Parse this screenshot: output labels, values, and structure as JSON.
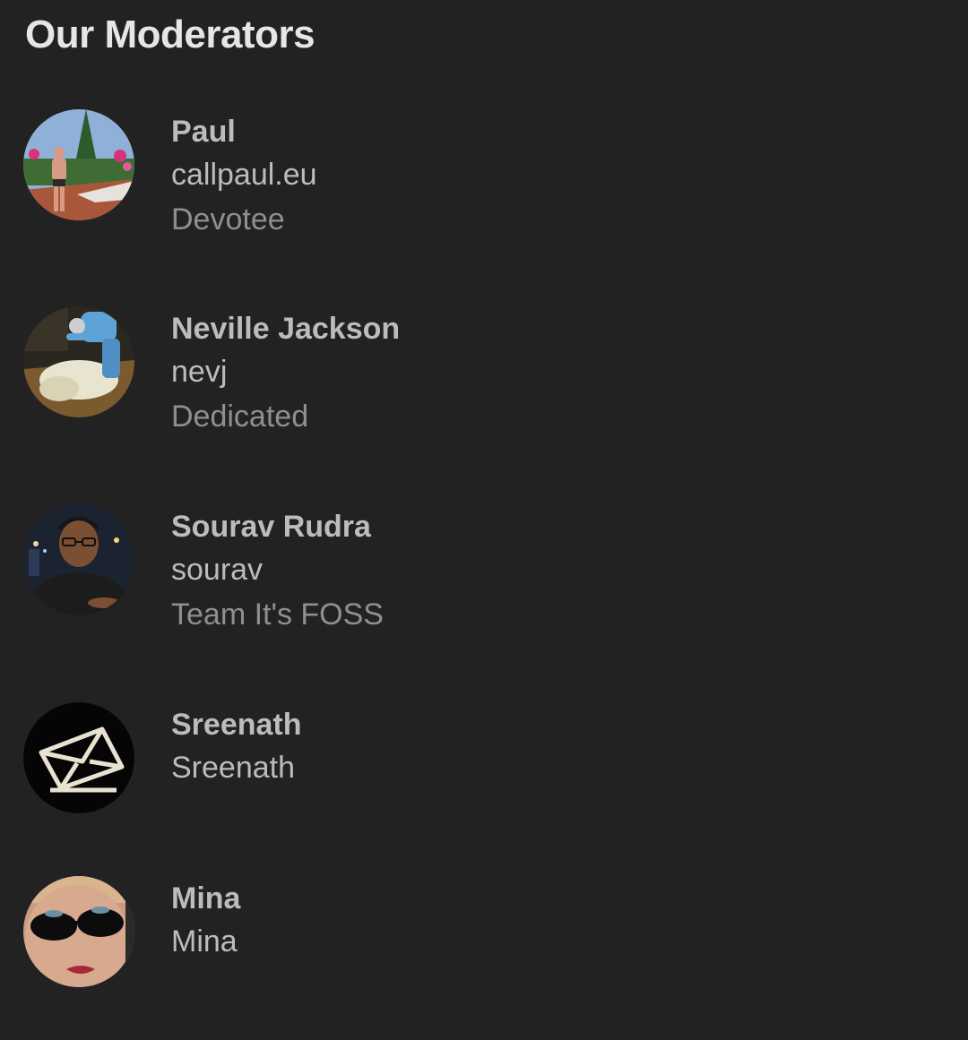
{
  "page": {
    "title": "Our Moderators",
    "background": "#222222",
    "text_color": "#bcbcbc",
    "muted_color": "#8f8f8f"
  },
  "moderators": [
    {
      "name": "Paul",
      "username": "callpaul.eu",
      "title": "Devotee",
      "avatar_icon": "photo-man-on-terrace"
    },
    {
      "name": "Neville Jackson",
      "username": "nevj",
      "title": "Dedicated",
      "avatar_icon": "photo-sheep-shearing"
    },
    {
      "name": "Sourav Rudra",
      "username": "sourav",
      "title": "Team It's FOSS",
      "avatar_icon": "photo-man-glasses"
    },
    {
      "name": "Sreenath",
      "username": "Sreenath",
      "avatar_icon": "envelope-icon"
    },
    {
      "name": "Mina",
      "username": "Mina",
      "avatar_icon": "photo-woman-sunglasses"
    }
  ]
}
